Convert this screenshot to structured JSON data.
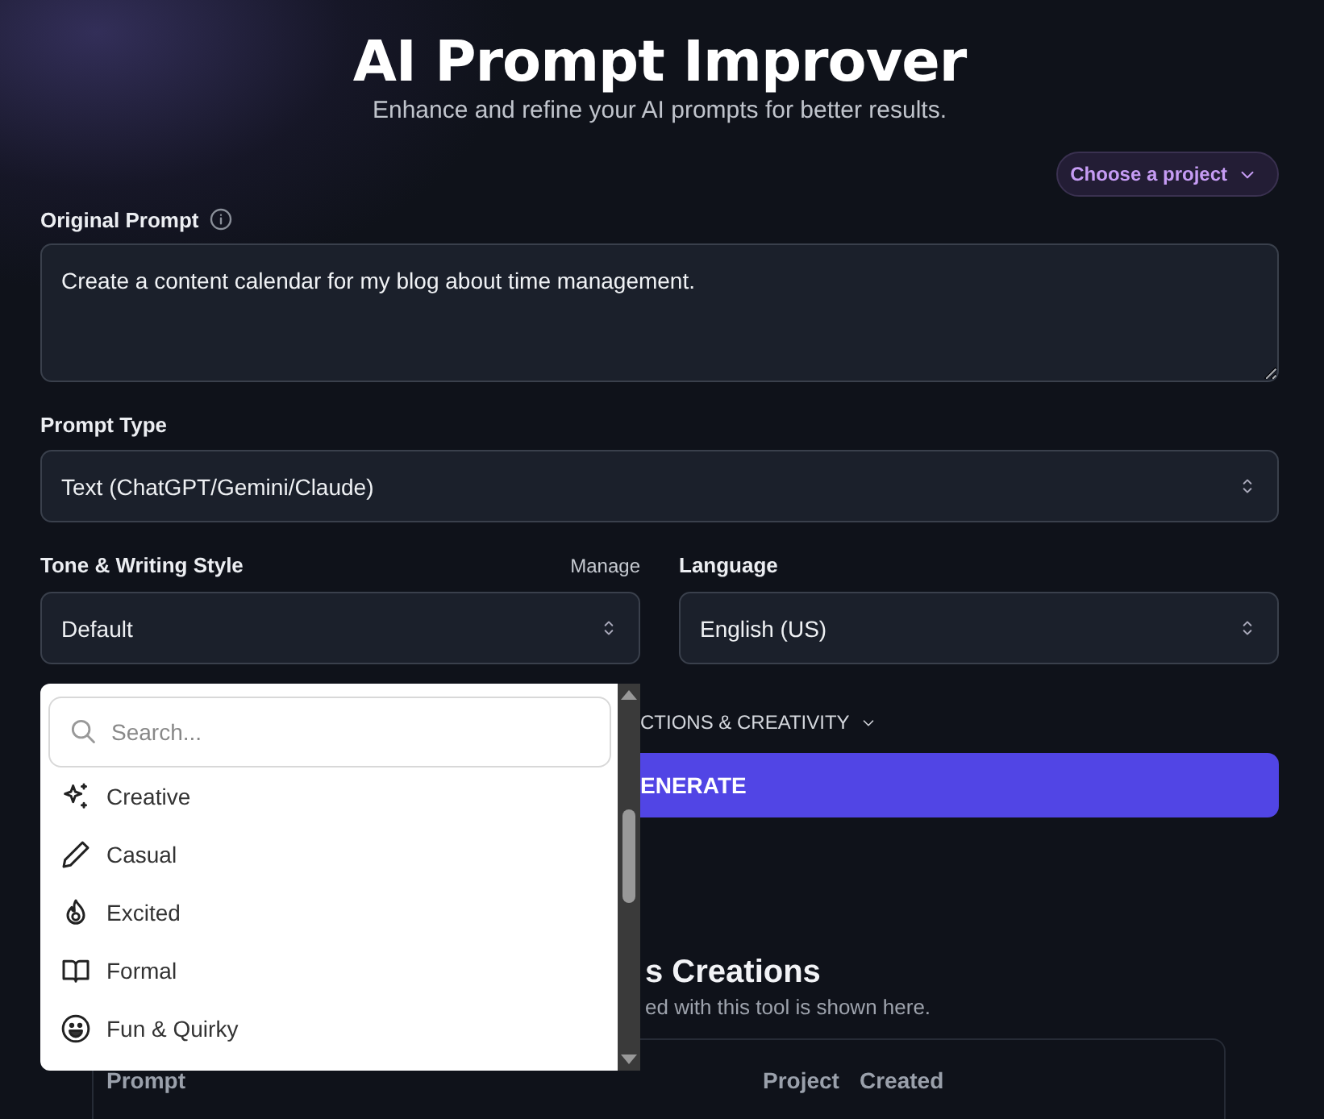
{
  "header": {
    "title": "AI Prompt Improver",
    "subtitle": "Enhance and refine your AI prompts for better results."
  },
  "project_picker": {
    "label": "Choose a project"
  },
  "original_prompt": {
    "label": "Original Prompt",
    "value": "Create a content calendar for my blog about time management."
  },
  "prompt_type": {
    "label": "Prompt Type",
    "value": "Text (ChatGPT/Gemini/Claude)"
  },
  "tone": {
    "label": "Tone & Writing Style",
    "manage": "Manage",
    "value": "Default"
  },
  "language": {
    "label": "Language",
    "value": "English (US)"
  },
  "options_toggle": {
    "label": "CTIONS & CREATIVITY"
  },
  "generate_button": {
    "label": "ENERATE"
  },
  "creations": {
    "title": "s Creations",
    "subtitle": "ed with this tool is shown here.",
    "columns": [
      "Prompt",
      "Project",
      "Created"
    ]
  },
  "tone_dropdown": {
    "search": {
      "placeholder": "Search..."
    },
    "options": [
      {
        "label": "Creative",
        "kind": "sparkles"
      },
      {
        "label": "Casual",
        "kind": "pencil"
      },
      {
        "label": "Excited",
        "kind": "flame"
      },
      {
        "label": "Formal",
        "kind": "book"
      },
      {
        "label": "Fun & Quirky",
        "kind": "smile"
      }
    ]
  }
}
